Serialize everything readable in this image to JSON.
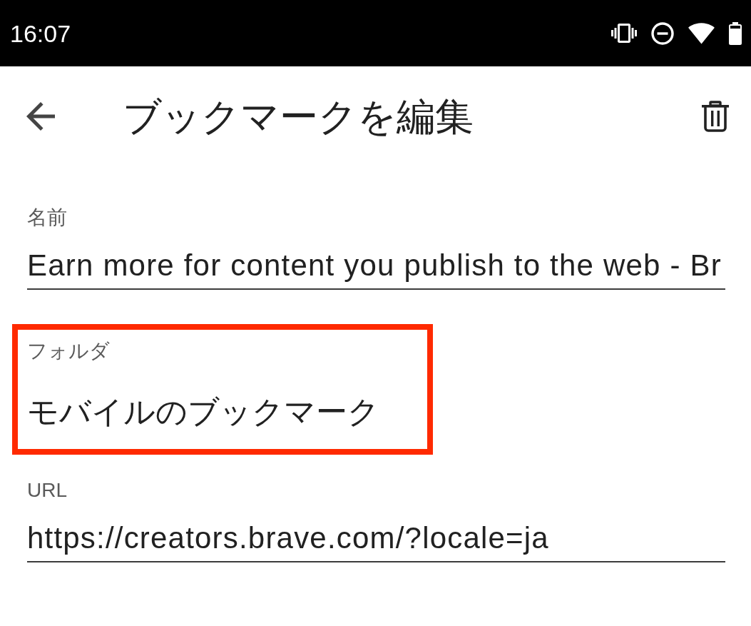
{
  "status_bar": {
    "time": "16:07"
  },
  "app_bar": {
    "title": "ブックマークを編集"
  },
  "fields": [
    {
      "kind": "text",
      "label": "名前",
      "value": "Earn more for content you publish to the web - Br",
      "highlighted": false
    },
    {
      "kind": "select",
      "label": "フォルダ",
      "value": "モバイルのブックマーク",
      "highlighted": true
    },
    {
      "kind": "text",
      "label": "URL",
      "value": "https://creators.brave.com/?locale=ja",
      "highlighted": false
    }
  ]
}
